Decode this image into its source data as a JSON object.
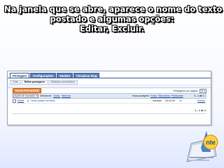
{
  "caption": {
    "line1": "Na janela que se abre, aparece o nome do texto",
    "line2": "postado e algumas opções:",
    "line3": "Editar, Excluir."
  },
  "blogger": {
    "tabs": [
      "Postagem",
      "Configurações",
      "Modelo",
      "Visualizar blog"
    ],
    "subtabs": [
      "Criar",
      "Editar postagens",
      "Moderar comentários"
    ],
    "new_post_button": "NOVA POSTAGEM",
    "posts_per_page_label": "Postagens por página",
    "posts_per_page_value": "25",
    "actions_select": "Ações de marcador",
    "select_label": "Selecionar:",
    "select_all": "Todos,",
    "select_none": "Nenhum",
    "pager": "1 - 1 de 1",
    "filter_label": "Suas postagens:",
    "filter_all": "Todos,",
    "filter_drafts": "Rascunhos,",
    "filter_published": "Publicadas",
    "post": {
      "edit_label": "Editar",
      "title": "Como postar um texto",
      "status": "nalusale",
      "time": "02:02:00",
      "author": "de",
      "delete_label": "Excluir"
    }
  },
  "logo": {
    "text": "nte"
  }
}
